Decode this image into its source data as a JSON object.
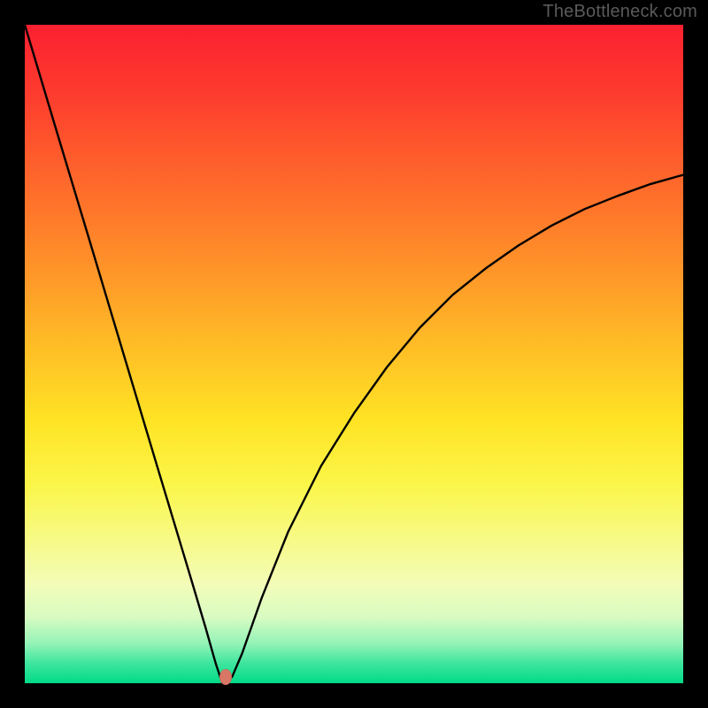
{
  "watermark": "TheBottleneck.com",
  "chart_data": {
    "type": "line",
    "title": "",
    "xlabel": "",
    "ylabel": "",
    "xlim": [
      0,
      1
    ],
    "ylim": [
      0,
      1
    ],
    "grid": false,
    "legend": false,
    "background": "rainbow-vertical-gradient",
    "series": [
      {
        "name": "bottleneck-curve",
        "comment": "V-shaped curve: steep linear descent from top-left to a minimum near x≈0.30 at y≈0, then an asymptotic rise toward the right edge reaching roughly y≈0.77 at x=1. Values are fractions of the plot area (0 at bottom-left).",
        "x": [
          0.0,
          0.05,
          0.1,
          0.15,
          0.2,
          0.25,
          0.275,
          0.29,
          0.3,
          0.305,
          0.315,
          0.33,
          0.36,
          0.4,
          0.45,
          0.5,
          0.55,
          0.6,
          0.65,
          0.7,
          0.75,
          0.8,
          0.85,
          0.9,
          0.95,
          1.0
        ],
        "values": [
          1.0,
          0.833,
          0.667,
          0.5,
          0.333,
          0.167,
          0.083,
          0.03,
          0.0,
          0.0,
          0.01,
          0.045,
          0.13,
          0.23,
          0.33,
          0.41,
          0.48,
          0.54,
          0.59,
          0.63,
          0.665,
          0.695,
          0.72,
          0.74,
          0.758,
          0.772
        ]
      }
    ],
    "marker": {
      "x": 0.305,
      "y": 0.01,
      "color": "#d97766"
    }
  },
  "colors": {
    "frame": "#000000",
    "curve": "#000000",
    "marker": "#d97766",
    "watermark": "#5a5a5a"
  }
}
